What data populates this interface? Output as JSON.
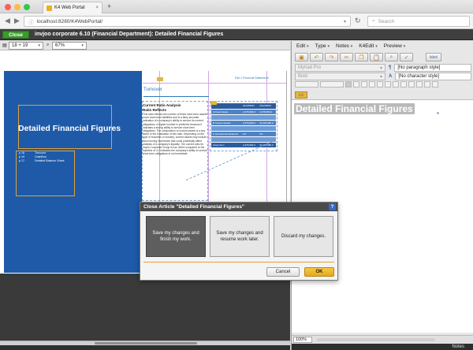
{
  "browser": {
    "tab_title": "K4 Web Portal",
    "tab_close": "×",
    "new_tab": "+",
    "url": "localhost:8280/K4WebPortal/",
    "search_placeholder": "Search"
  },
  "app": {
    "close_label": "Close",
    "title": "invjoo corporate 6.10 (Financial Department): Detailed Financial Figures"
  },
  "left_toolbar": {
    "spread_value": "18 + 19",
    "zoom_value": "67%"
  },
  "layout": {
    "title": "Detailed Financial Figures",
    "toc": [
      {
        "page": "p 18",
        "text": "Turnover"
      },
      {
        "page": "p 19",
        "text": "Cashflow"
      },
      {
        "page": "p 17",
        "text": "Detailed Balance Sheet"
      }
    ],
    "turnover_heading": "Turnover",
    "page_header": "Part 1 Financial Statements",
    "article_subhead_1": "Current Ratio Analysis",
    "article_subhead_2": "Ratio Reflects",
    "article_body": "This ratio reflects the number of times short-term assets cover short-term liabilities and is a fairly accurate indication of a company's ability to service its current obligations. A higher number is preferred because it indicates a strong ability to service short-term obligations. The composition of current assets is a key factor in the evaluation of this ratio. Depending on the type of business or industry, current assets may include slow moving inventories that could potentially affect analysis of a company's liquidity. The current ratio for invjoo Corporate Group is low, which compared to the baseline of 4.0 indicates the company's ability to service short-term obligations is not immediate.",
    "table": [
      {
        "k": "",
        "a": "2013/08/31",
        "b": "2012/08/31",
        "style": "h"
      },
      {
        "k": "A Fixed Assets",
        "a": "2,378,683.0",
        "b": "2,378,683.0",
        "style": "r"
      },
      {
        "k": "",
        "a": "",
        "b": "",
        "style": "a"
      },
      {
        "k": "B Current Assets",
        "a": "2,378,683.0",
        "b": "32,425,686.0",
        "style": "r"
      },
      {
        "k": "",
        "a": "",
        "b": "",
        "style": "a"
      },
      {
        "k": "C Accrued and deferred",
        "a": "0.0",
        "b": "0.0",
        "style": "r"
      },
      {
        "k": "",
        "a": "",
        "b": "",
        "style": "a"
      },
      {
        "k": "Asset Sum",
        "a": "2,378,683.0",
        "b": "32,425,686.0",
        "style": "h"
      }
    ]
  },
  "right_panel": {
    "menu": [
      "Edit",
      "Type",
      "Notes",
      "K4Edit",
      "Preview"
    ],
    "menu_arrow": "▾",
    "label_btn": "label",
    "font_family": "Myriad Pro",
    "font_style": "Bold",
    "paragraph_style": "[No paragraph style]",
    "character_style": "[No character style]",
    "para_badge": "¶",
    "char_badge": "A",
    "editor_text": "Detailed Financial Figures",
    "zoom": "100%",
    "notes_label": "Notes"
  },
  "modal": {
    "title": "Close Article \"Detailed Financial Figures\"",
    "help": "?",
    "choices": [
      "Save my changes and finish my work.",
      "Save my changes and resume work later.",
      "Discard my changes."
    ],
    "cancel_label": "Cancel",
    "ok_label": "OK"
  }
}
